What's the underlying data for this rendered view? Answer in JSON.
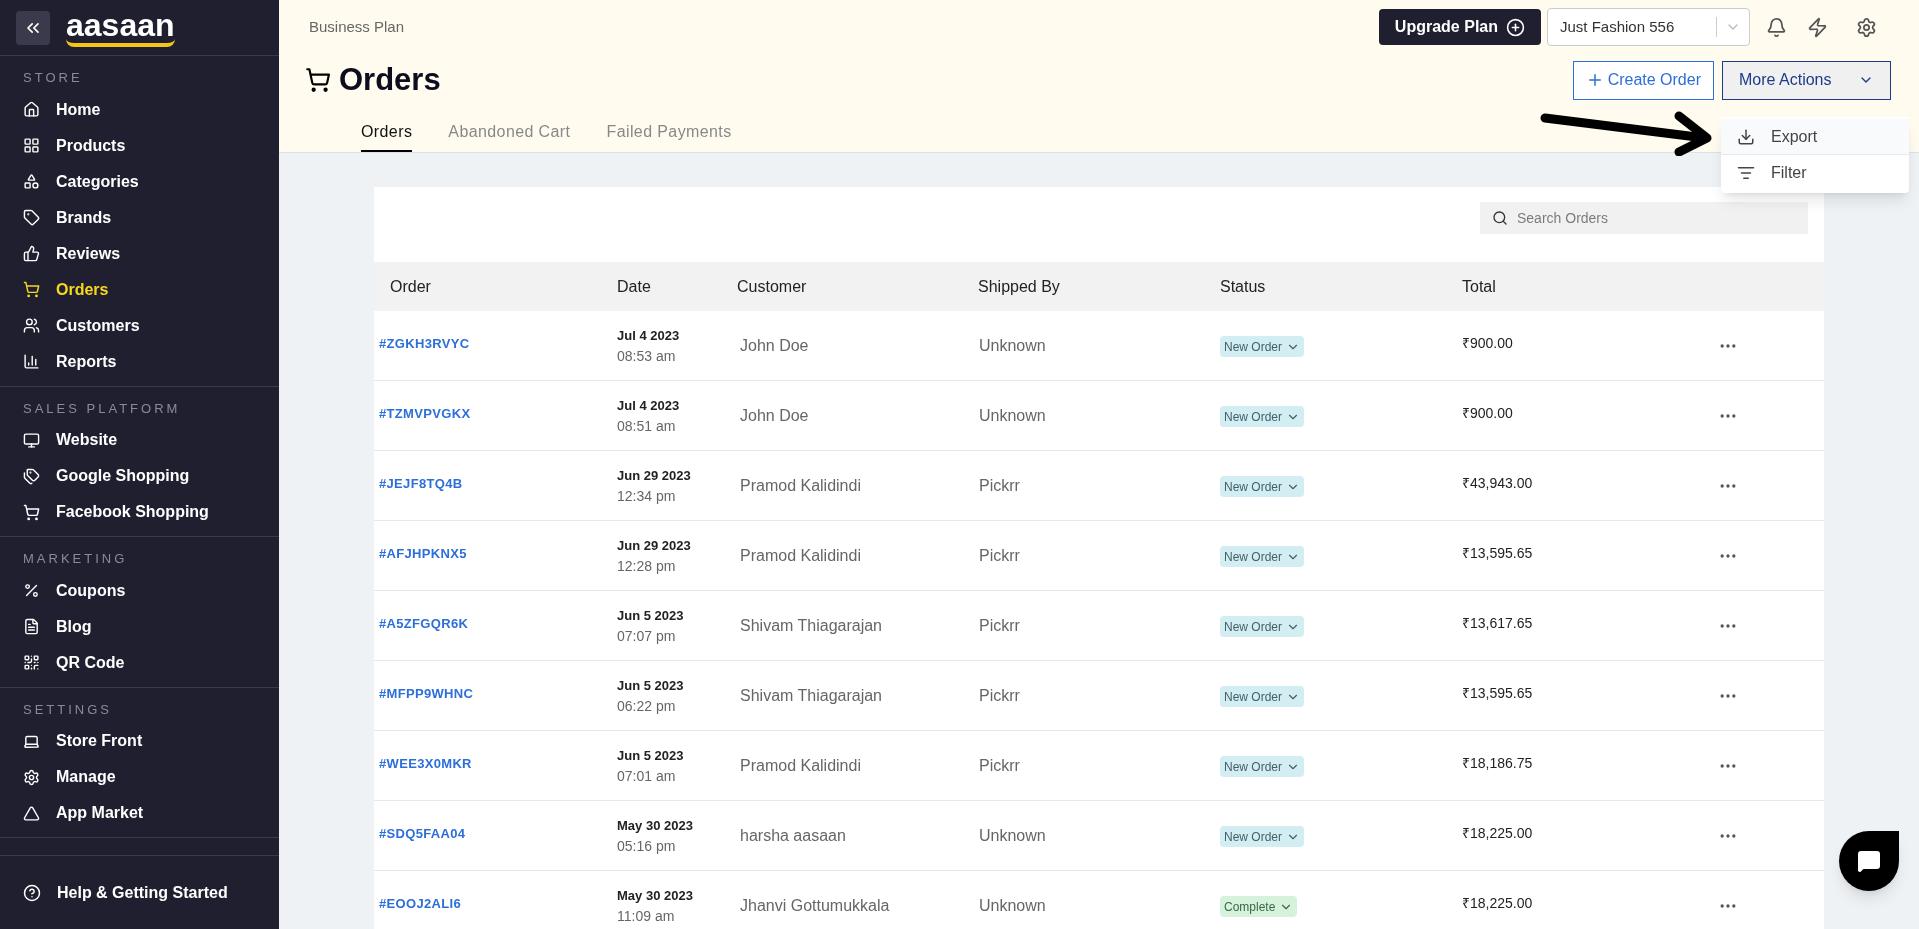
{
  "sidebar": {
    "logo": "aasaan",
    "sections": [
      {
        "title": "STORE",
        "items": [
          {
            "label": "Home",
            "selected": false
          },
          {
            "label": "Products",
            "selected": false
          },
          {
            "label": "Categories",
            "selected": false
          },
          {
            "label": "Brands",
            "selected": false
          },
          {
            "label": "Reviews",
            "selected": false
          },
          {
            "label": "Orders",
            "selected": true
          },
          {
            "label": "Customers",
            "selected": false
          },
          {
            "label": "Reports",
            "selected": false
          }
        ]
      },
      {
        "title": "SALES PLATFORM",
        "items": [
          {
            "label": "Website",
            "selected": false
          },
          {
            "label": "Google Shopping",
            "selected": false
          },
          {
            "label": "Facebook Shopping",
            "selected": false
          }
        ]
      },
      {
        "title": "MARKETING",
        "items": [
          {
            "label": "Coupons",
            "selected": false
          },
          {
            "label": "Blog",
            "selected": false
          },
          {
            "label": "QR Code",
            "selected": false
          }
        ]
      },
      {
        "title": "SETTINGS",
        "items": [
          {
            "label": "Store Front",
            "selected": false
          },
          {
            "label": "Manage",
            "selected": false
          },
          {
            "label": "App Market",
            "selected": false
          }
        ]
      }
    ],
    "help": "Help & Getting Started"
  },
  "topbar": {
    "plan": "Business Plan",
    "upgrade": "Upgrade Plan",
    "store": "Just Fashion 556"
  },
  "page": {
    "title": "Orders",
    "create": "Create Order",
    "more": "More Actions",
    "menu": [
      {
        "label": "Export",
        "selected": true
      },
      {
        "label": "Filter",
        "selected": false
      }
    ],
    "tabs": [
      {
        "label": "Orders",
        "selected": true
      },
      {
        "label": "Abandoned Cart",
        "selected": false
      },
      {
        "label": "Failed Payments",
        "selected": false
      }
    ]
  },
  "table": {
    "search_placeholder": "Search Orders",
    "columns": [
      "Order",
      "Date",
      "Customer",
      "Shipped By",
      "Status",
      "Total"
    ],
    "rows": [
      {
        "order": "#ZGKH3RVYC",
        "date": "Jul 4 2023",
        "time": "08:53 am",
        "customer": "John Doe",
        "shipped_by": "Unknown",
        "status": "New Order",
        "kind": "new",
        "total": "₹900.00"
      },
      {
        "order": "#TZMVPVGKX",
        "date": "Jul 4 2023",
        "time": "08:51 am",
        "customer": "John Doe",
        "shipped_by": "Unknown",
        "status": "New Order",
        "kind": "new",
        "total": "₹900.00"
      },
      {
        "order": "#JEJF8TQ4B",
        "date": "Jun 29 2023",
        "time": "12:34 pm",
        "customer": "Pramod Kalidindi",
        "shipped_by": "Pickrr",
        "status": "New Order",
        "kind": "new",
        "total": "₹43,943.00"
      },
      {
        "order": "#AFJHPKNX5",
        "date": "Jun 29 2023",
        "time": "12:28 pm",
        "customer": "Pramod Kalidindi",
        "shipped_by": "Pickrr",
        "status": "New Order",
        "kind": "new",
        "total": "₹13,595.65"
      },
      {
        "order": "#A5ZFGQR6K",
        "date": "Jun 5 2023",
        "time": "07:07 pm",
        "customer": "Shivam Thiagarajan",
        "shipped_by": "Pickrr",
        "status": "New Order",
        "kind": "new",
        "total": "₹13,617.65"
      },
      {
        "order": "#MFPP9WHNC",
        "date": "Jun 5 2023",
        "time": "06:22 pm",
        "customer": "Shivam Thiagarajan",
        "shipped_by": "Pickrr",
        "status": "New Order",
        "kind": "new",
        "total": "₹13,595.65"
      },
      {
        "order": "#WEE3X0MKR",
        "date": "Jun 5 2023",
        "time": "07:01 am",
        "customer": "Pramod Kalidindi",
        "shipped_by": "Pickrr",
        "status": "New Order",
        "kind": "new",
        "total": "₹18,186.75"
      },
      {
        "order": "#SDQ5FAA04",
        "date": "May 30 2023",
        "time": "05:16 pm",
        "customer": "harsha aasaan",
        "shipped_by": "Unknown",
        "status": "New Order",
        "kind": "new",
        "total": "₹18,225.00"
      },
      {
        "order": "#EOOJ2ALI6",
        "date": "May 30 2023",
        "time": "11:09 am",
        "customer": "Jhanvi Gottumukkala",
        "shipped_by": "Unknown",
        "status": "Complete",
        "kind": "complete",
        "total": "₹18,225.00"
      }
    ]
  }
}
